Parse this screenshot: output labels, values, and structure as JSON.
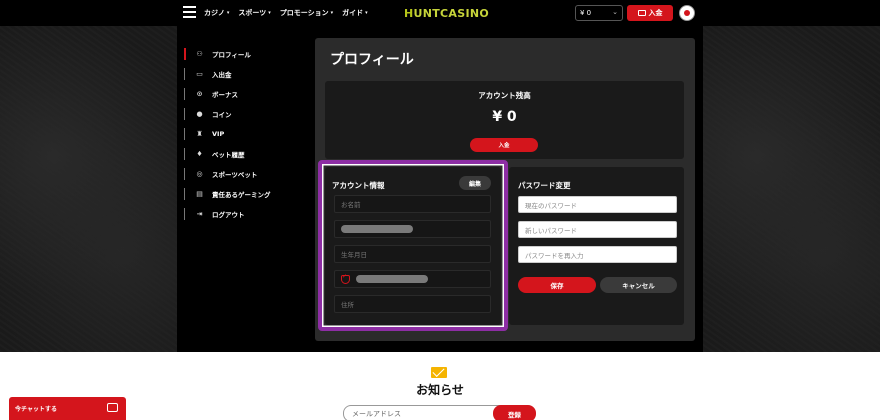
{
  "topbar": {
    "nav": [
      {
        "label": "カジノ"
      },
      {
        "label": "スポーツ"
      },
      {
        "label": "プロモーション"
      },
      {
        "label": "ガイド"
      }
    ],
    "logo_h": "H",
    "logo_rest": "UNTCASINO",
    "balance": "¥ 0",
    "deposit_label": "入金"
  },
  "sidebar": {
    "items": [
      {
        "label": "プロフィール",
        "icon": "user-icon"
      },
      {
        "label": "入出金",
        "icon": "wallet-icon"
      },
      {
        "label": "ボーナス",
        "icon": "bonus-icon"
      },
      {
        "label": "コイン",
        "icon": "coin-icon"
      },
      {
        "label": "VIP",
        "icon": "vip-icon"
      },
      {
        "label": "ベット履歴",
        "icon": "diamond-icon"
      },
      {
        "label": "スポーツベット",
        "icon": "ball-icon"
      },
      {
        "label": "責任あるゲーミング",
        "icon": "document-icon"
      },
      {
        "label": "ログアウト",
        "icon": "logout-icon"
      }
    ]
  },
  "profile": {
    "title": "プロフィール",
    "balance_label": "アカウント残高",
    "balance_value": "¥ 0",
    "deposit_label": "入金",
    "info": {
      "title": "アカウント情報",
      "edit_label": "編集",
      "name_placeholder": "お名前",
      "birthdate_placeholder": "生年月日",
      "address_placeholder": "住所"
    },
    "password": {
      "title": "パスワード変更",
      "current_placeholder": "現在のパスワード",
      "new_placeholder": "新しいパスワード",
      "confirm_placeholder": "パスワードを再入力",
      "save_label": "保存",
      "cancel_label": "キャンセル"
    }
  },
  "newsletter": {
    "title": "お知らせ",
    "email_placeholder": "メールアドレス",
    "register_label": "登録"
  },
  "chat": {
    "label": "今チャットする"
  },
  "colors": {
    "accent_red": "#d4151c",
    "highlight_purple": "#8d2ea4",
    "logo_green": "#c6d43a"
  }
}
